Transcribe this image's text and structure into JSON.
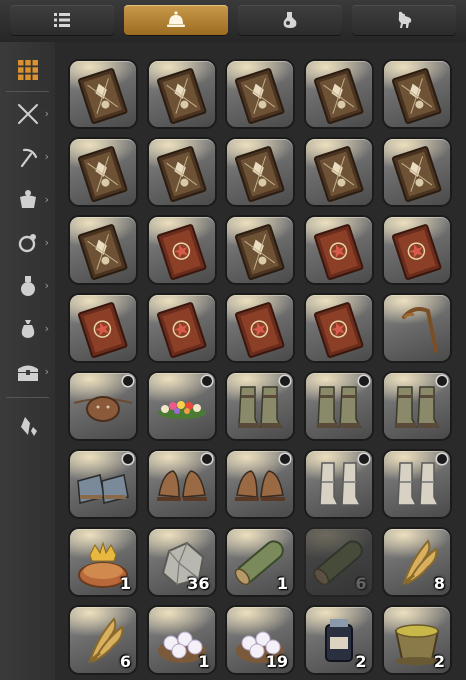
{
  "tabs": [
    {
      "icon": "list-icon",
      "active": false
    },
    {
      "icon": "bell-icon",
      "active": true
    },
    {
      "icon": "potion-icon",
      "active": false
    },
    {
      "icon": "chocobo-icon",
      "active": false
    }
  ],
  "sidebar": [
    {
      "icon": "grid-icon",
      "selected": true,
      "has_chevron": false
    },
    {
      "icon": "crossed-swords-icon",
      "has_chevron": true
    },
    {
      "icon": "pickaxe-icon",
      "has_chevron": true
    },
    {
      "icon": "armor-icon",
      "has_chevron": true
    },
    {
      "icon": "ring-icon",
      "has_chevron": true
    },
    {
      "icon": "flask-icon",
      "has_chevron": true
    },
    {
      "icon": "bag-icon",
      "has_chevron": true
    },
    {
      "icon": "chest-icon",
      "has_chevron": true
    },
    {
      "icon": "crystal-icon",
      "has_chevron": false
    }
  ],
  "chevron_glyph": "›",
  "accent_color": "#d9922e",
  "inventory": [
    {
      "item": "tome-icon"
    },
    {
      "item": "tome-icon"
    },
    {
      "item": "tome-icon"
    },
    {
      "item": "tome-icon"
    },
    {
      "item": "tome-icon"
    },
    {
      "item": "tome-icon"
    },
    {
      "item": "tome-icon"
    },
    {
      "item": "tome-icon"
    },
    {
      "item": "tome-icon"
    },
    {
      "item": "tome-icon"
    },
    {
      "item": "tome-icon"
    },
    {
      "item": "red-tome-icon"
    },
    {
      "item": "tome-icon"
    },
    {
      "item": "red-tome-icon"
    },
    {
      "item": "red-tome-icon"
    },
    {
      "item": "red-tome-icon"
    },
    {
      "item": "red-tome-icon"
    },
    {
      "item": "red-tome-icon"
    },
    {
      "item": "red-tome-icon"
    },
    {
      "item": "cane-icon"
    },
    {
      "item": "eyepatch-icon",
      "badge": true
    },
    {
      "item": "flower-crown-icon",
      "badge": true
    },
    {
      "item": "boots-icon",
      "badge": true
    },
    {
      "item": "boots-icon",
      "badge": true
    },
    {
      "item": "boots-icon",
      "badge": true
    },
    {
      "item": "armored-shoes-icon",
      "badge": true
    },
    {
      "item": "sandals-icon",
      "badge": true
    },
    {
      "item": "sandals-icon",
      "badge": true
    },
    {
      "item": "white-boots-icon",
      "badge": true
    },
    {
      "item": "white-boots-icon",
      "badge": true
    },
    {
      "item": "crown-pie-icon",
      "qty": "1"
    },
    {
      "item": "ore-icon",
      "qty": "36"
    },
    {
      "item": "log-icon",
      "qty": "1"
    },
    {
      "item": "log-icon",
      "qty": "6",
      "dim": true
    },
    {
      "item": "wheat-icon",
      "qty": "8"
    },
    {
      "item": "wheat-icon",
      "qty": "6"
    },
    {
      "item": "eggs-icon",
      "qty": "1"
    },
    {
      "item": "eggs-icon",
      "qty": "19"
    },
    {
      "item": "ink-jar-icon",
      "qty": "2"
    },
    {
      "item": "bowl-icon",
      "qty": "2"
    }
  ]
}
